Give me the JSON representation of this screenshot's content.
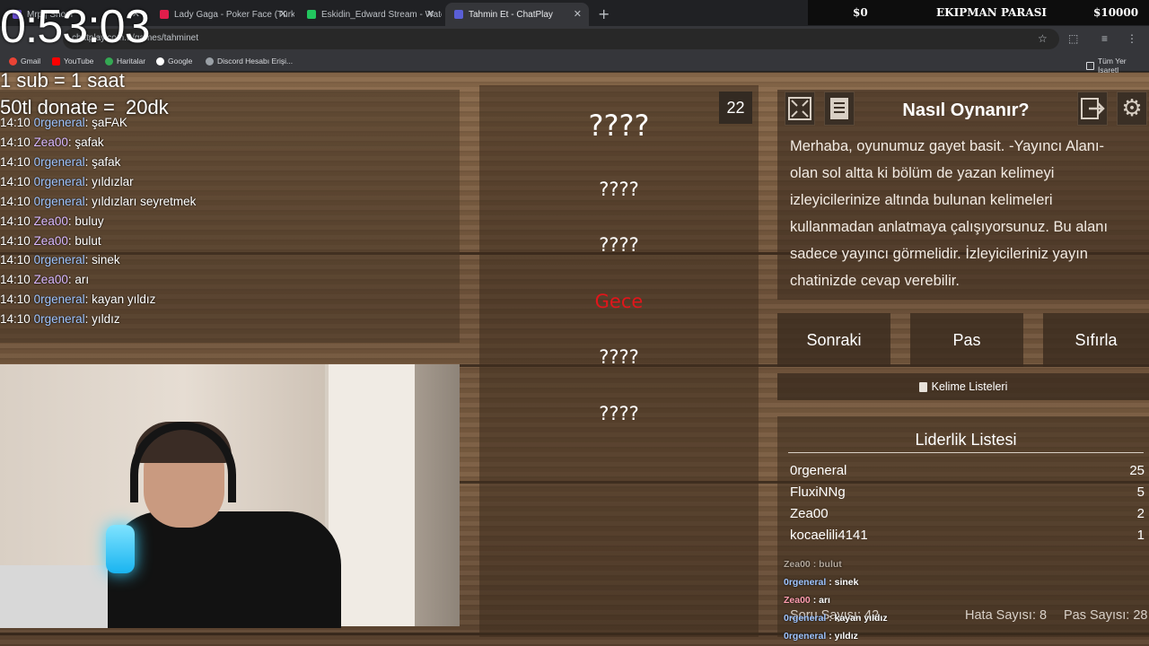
{
  "browser": {
    "tabs": [
      {
        "title": "Mrp | Shopi",
        "color": "#6b4fd6",
        "active": false
      },
      {
        "title": "Lady Gaga - Poker Face (Türkçe",
        "color": "#e01e4b",
        "active": false
      },
      {
        "title": "Eskidin_Edward Stream - Watch",
        "color": "#22c55e",
        "active": false
      },
      {
        "title": "Tahmin Et - ChatPlay",
        "color": "#5a5fd6",
        "active": true
      }
    ],
    "url": "chatplay.com.tr/games/tahminet",
    "bookmarks": [
      "Gmail",
      "YouTube",
      "Haritalar",
      "Google",
      "Discord Hesabı Erişi...",
      "Tüm Yer İşaretl"
    ]
  },
  "overlay": {
    "money_left": "$0",
    "money_title": "EKIPMAN PARASI",
    "money_right": "$10000",
    "timer": "0:53:03",
    "line1": "1 sub = 1 saat",
    "line2": "50tl donate =  20dk"
  },
  "chat": [
    {
      "time": "14:10",
      "user": "0rgeneral",
      "msg": "şaFAK"
    },
    {
      "time": "14:10",
      "user": "Zea00",
      "msg": "şafak"
    },
    {
      "time": "14:10",
      "user": "0rgeneral",
      "msg": "şafak"
    },
    {
      "time": "14:10",
      "user": "0rgeneral",
      "msg": "yıldızlar"
    },
    {
      "time": "14:10",
      "user": "0rgeneral",
      "msg": "yıldızları seyretmek"
    },
    {
      "time": "14:10",
      "user": "Zea00",
      "msg": "buluy"
    },
    {
      "time": "14:10",
      "user": "Zea00",
      "msg": "bulut"
    },
    {
      "time": "14:10",
      "user": "0rgeneral",
      "msg": "sinek"
    },
    {
      "time": "14:10",
      "user": "Zea00",
      "msg": "arı"
    },
    {
      "time": "14:10",
      "user": "0rgeneral",
      "msg": "kayan yıldız"
    },
    {
      "time": "14:10",
      "user": "0rgeneral",
      "msg": "yıldız"
    }
  ],
  "game": {
    "counter": "22",
    "words": [
      "????",
      "????",
      "????",
      "Gece",
      "????",
      "????"
    ],
    "help_title": "Nasıl Oynanır?",
    "help_text": "Merhaba, oyunumuz gayet basit. -Yayıncı Alanı- olan sol altta ki bölüm de yazan kelimeyi izleyicilerinize altında bulunan kelimeleri kullanmadan anlatmaya çalışıyorsunuz. Bu alanı sadece yayıncı görmelidir. İzleyicileriniz yayın chatinizde cevap verebilir.",
    "btn_next": "Sonraki",
    "btn_pass": "Pas",
    "btn_reset": "Sıfırla",
    "word_lists": "Kelime Listeleri",
    "leader_title": "Liderlik Listesi",
    "leaders": [
      {
        "name": "0rgeneral",
        "score": "25"
      },
      {
        "name": "FluxiNNg",
        "score": "5"
      },
      {
        "name": "Zea00",
        "score": "2"
      },
      {
        "name": "kocaelili4141",
        "score": "1"
      }
    ],
    "mini_chat": [
      {
        "user": "Zea00",
        "msg": "bulut",
        "dim": true
      },
      {
        "user": "0rgeneral",
        "msg": "sinek",
        "dim": false
      },
      {
        "user": "Zea00",
        "msg": "arı",
        "dim": false
      },
      {
        "user": "0rgeneral",
        "msg": "kayan yıldız",
        "dim": false
      },
      {
        "user": "0rgeneral",
        "msg": "yıldız",
        "dim": false
      }
    ],
    "question_count": "Soru Sayısı: 42",
    "error_count": "Hata Sayısı: 8",
    "pass_count": "Pas Sayısı: 28"
  }
}
